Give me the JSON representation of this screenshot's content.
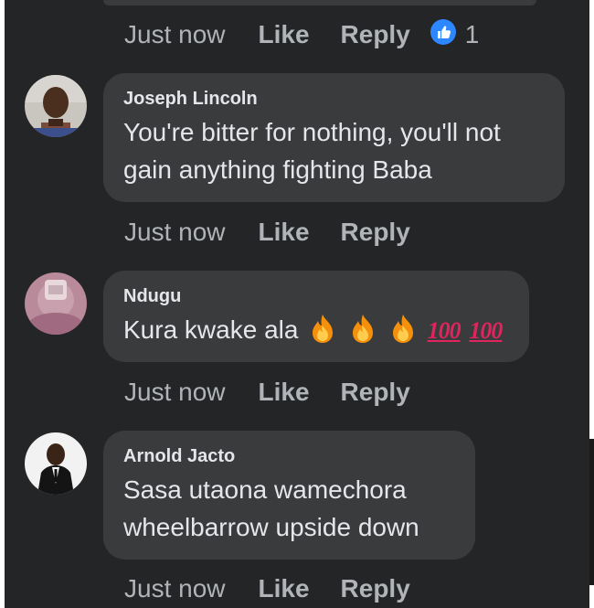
{
  "top_comment": {
    "time": "Just now",
    "like_label": "Like",
    "reply_label": "Reply",
    "reaction_count": "1"
  },
  "comments": [
    {
      "author": "Joseph Lincoln",
      "text": "You're bitter for nothing, you'll not gain anything fighting Baba",
      "time": "Just now",
      "like_label": "Like",
      "reply_label": "Reply"
    },
    {
      "author": "Ndugu",
      "text": "Kura kwake ala",
      "emojis": [
        "fire",
        "fire",
        "fire",
        "hundred-points",
        "hundred-points"
      ],
      "hundred_glyph": "100",
      "time": "Just now",
      "like_label": "Like",
      "reply_label": "Reply"
    },
    {
      "author": "Arnold Jacto",
      "text": "Sasa utaona wamechora wheelbarrow upside down",
      "time": "Just now",
      "like_label": "Like",
      "reply_label": "Reply"
    }
  ],
  "colors": {
    "background": "#242526",
    "bubble": "#3a3b3c",
    "primary_text": "#e4e6eb",
    "secondary_text": "#b0b3b8",
    "like_blue": "#2d88ff",
    "hundred_red": "#e0245e"
  }
}
